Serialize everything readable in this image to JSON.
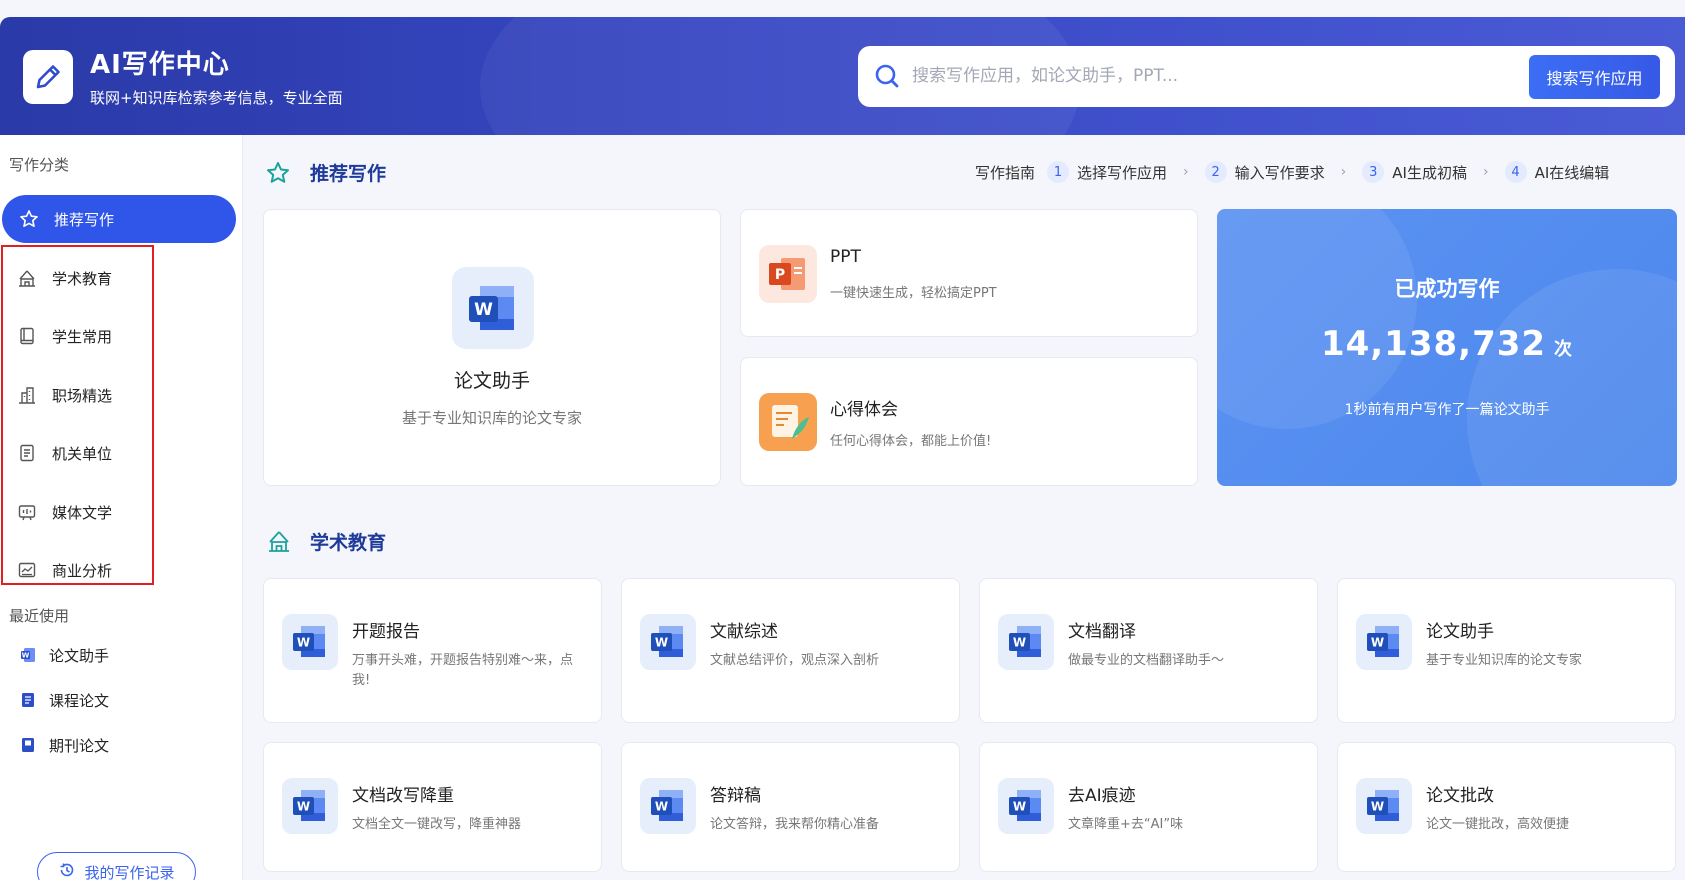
{
  "header": {
    "title": "AI写作中心",
    "subtitle": "联网+知识库检索参考信息，专业全面",
    "search_placeholder": "搜索写作应用，如论文助手，PPT...",
    "search_button": "搜索写作应用"
  },
  "sidebar": {
    "category_heading": "写作分类",
    "categories": [
      {
        "label": "推荐写作",
        "icon": "star-icon",
        "active": true
      },
      {
        "label": "学术教育",
        "icon": "academy-icon"
      },
      {
        "label": "学生常用",
        "icon": "book-icon"
      },
      {
        "label": "职场精选",
        "icon": "building-icon"
      },
      {
        "label": "机关单位",
        "icon": "document-icon"
      },
      {
        "label": "媒体文学",
        "icon": "media-icon"
      },
      {
        "label": "商业分析",
        "icon": "chart-icon"
      }
    ],
    "recent_heading": "最近使用",
    "recent": [
      {
        "label": "论文助手",
        "icon": "word-icon"
      },
      {
        "label": "课程论文",
        "icon": "course-icon"
      },
      {
        "label": "期刊论文",
        "icon": "journal-icon"
      }
    ],
    "history_button": "我的写作记录"
  },
  "recommended": {
    "title": "推荐写作",
    "guide_label": "写作指南",
    "steps": [
      {
        "num": "1",
        "label": "选择写作应用"
      },
      {
        "num": "2",
        "label": "输入写作要求"
      },
      {
        "num": "3",
        "label": "AI生成初稿"
      },
      {
        "num": "4",
        "label": "AI在线编辑"
      }
    ],
    "feature": {
      "title": "论文助手",
      "desc": "基于专业知识库的论文专家"
    },
    "ppt": {
      "title": "PPT",
      "desc": "一键快速生成，轻松搞定PPT"
    },
    "experience": {
      "title": "心得体会",
      "desc": "任何心得体会，都能上价值!"
    },
    "stats": {
      "title": "已成功写作",
      "value": "14,138,732",
      "unit": "次",
      "desc": "1秒前有用户写作了一篇论文助手"
    }
  },
  "academic": {
    "title": "学术教育",
    "tools": [
      {
        "title": "开题报告",
        "desc": "万事开头难，开题报告特别难～来，点我!"
      },
      {
        "title": "文献综述",
        "desc": "文献总结评价，观点深入剖析"
      },
      {
        "title": "文档翻译",
        "desc": "做最专业的文档翻译助手～"
      },
      {
        "title": "论文助手",
        "desc": "基于专业知识库的论文专家"
      },
      {
        "title": "文档改写降重",
        "desc": "文档全文一键改写，降重神器"
      },
      {
        "title": "答辩稿",
        "desc": "论文答辩，我来帮你精心准备"
      },
      {
        "title": "去AI痕迹",
        "desc": "文章降重+去“AI”味"
      },
      {
        "title": "论文批改",
        "desc": "论文一键批改，高效便捷"
      }
    ]
  },
  "colors": {
    "primary": "#2f56e9",
    "header": "#3848c4",
    "stat": "#5b93f2",
    "accent_green": "#1aa39a"
  }
}
